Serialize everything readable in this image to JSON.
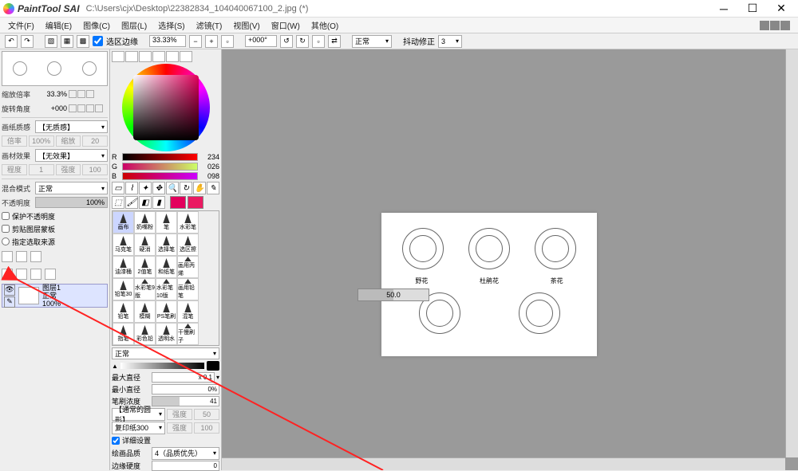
{
  "app": {
    "name": "PaintTool SAI",
    "path": "C:\\Users\\cjx\\Desktop\\22382834_104040067100_2.jpg (*)"
  },
  "menu": {
    "file": "文件(F)",
    "edit": "编辑(E)",
    "image": "图像(C)",
    "layer": "图层(L)",
    "select": "选择(S)",
    "filter": "滤镜(T)",
    "view": "视图(V)",
    "window": "窗口(W)",
    "other": "其他(O)"
  },
  "toolbar": {
    "select_edge_label": "选区边缘",
    "zoom": "33.33%",
    "rotate": "+000°",
    "blend_mode": "正常",
    "stabilizer_label": "抖动修正",
    "stabilizer_val": "3"
  },
  "nav": {
    "zoom_label": "缩放倍率",
    "zoom_val": "33.3%",
    "rotate_label": "旋转角度",
    "rotate_val": "+000"
  },
  "paper": {
    "texture_label": "画纸质感",
    "texture_val": "【无质感】",
    "rate_label": "倍率",
    "rate_val": "100%",
    "scale_label": "缩放",
    "scale_val": "20",
    "effect_label": "画材效果",
    "effect_val": "【无效果】",
    "depth_label": "程度",
    "depth_val": "1",
    "intensity_label": "强度",
    "intensity_val": "100"
  },
  "blend": {
    "mode_label": "混合模式",
    "mode_val": "正常",
    "opacity_label": "不透明度",
    "opacity_val": "100%"
  },
  "flags": {
    "protect": "保护不透明度",
    "clip": "剪贴图层蒙板",
    "source": "指定选取来源"
  },
  "layer": {
    "name": "图层1",
    "mode": "正常",
    "opacity": "100%"
  },
  "rgb": {
    "r": "234",
    "g": "026",
    "b": "098"
  },
  "brushes": [
    "画布",
    "奶嘴粉",
    "笔",
    "水彩笔",
    "马克笔",
    "硬消",
    "选择笔",
    "选区擦",
    "油漆桶",
    "2值笔",
    "和纸笔",
    "画用丙烯",
    "铅笔30",
    "水彩笔9版",
    "水彩笔10版",
    "画用铅笔",
    "铅笔",
    "模糊",
    "PS笔刷",
    "混笔",
    "指笔",
    "彩色铅",
    "透明水",
    "干慢刷子"
  ],
  "brush_mode": "正常",
  "brush_settings": {
    "max_label": "最大直径",
    "max_val": "x 0.1",
    "min_label": "最小直径",
    "min_val": "0%",
    "density_label": "笔刷浓度",
    "density_val": "41",
    "shape_label": "【通常的圆形】",
    "paper_label": "复印纸300",
    "paper_intensity": "强度",
    "paper_intensity_val": "100",
    "detail_chk": "详细设置",
    "quality_label": "绘画品质",
    "quality_val": "4（品质优先）",
    "edge_label": "边缘硬度",
    "edge_val": "0",
    "intensity_label": "强度",
    "intensity_val": "50"
  },
  "canvas": {
    "captions": [
      "野花",
      "杜鹃花",
      "茶花"
    ],
    "progress": "50.0"
  }
}
